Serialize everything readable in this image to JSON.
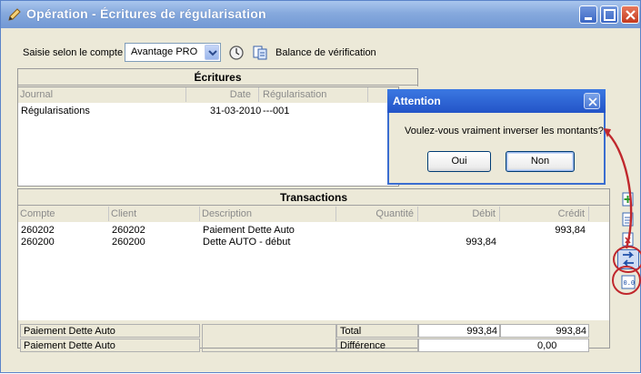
{
  "window": {
    "title": "Opération - Écritures de régularisation",
    "accent": "#7298d4"
  },
  "toolbar": {
    "mode_label": "Saisie selon le compte",
    "account_value": "Avantage PRO",
    "balance_label": "Balance de vérification"
  },
  "ecritures": {
    "header": "Écritures",
    "columns": [
      "Journal",
      "Date",
      "Régularisation"
    ],
    "rows": [
      {
        "journal": "Régularisations",
        "date": "31-03-2010",
        "regularisation": "---001"
      }
    ]
  },
  "transactions": {
    "header": "Transactions",
    "columns": [
      "Compte",
      "Client",
      "Description",
      "Quantité",
      "Débit",
      "Crédit"
    ],
    "rows": [
      {
        "compte": "260202",
        "client": "260202",
        "description": "Paiement Dette Auto",
        "quantite": "",
        "debit": "",
        "credit": "993,84"
      },
      {
        "compte": "260200",
        "client": "260200",
        "description": "Dette AUTO - début",
        "quantite": "",
        "debit": "993,84",
        "credit": ""
      }
    ],
    "footer": {
      "desc1": "Paiement Dette Auto",
      "desc2": "Paiement Dette Auto",
      "total_label": "Total",
      "total_debit": "993,84",
      "total_credit": "993,84",
      "diff_label": "Différence",
      "diff_value": "0,00"
    }
  },
  "dialog": {
    "title": "Attention",
    "message": "Voulez-vous vraiment inverser les montants?",
    "yes_label": "Oui",
    "no_label": "Non"
  },
  "colors": {
    "annotation_red": "#c0282d",
    "dialog_title": "#2354c8"
  }
}
